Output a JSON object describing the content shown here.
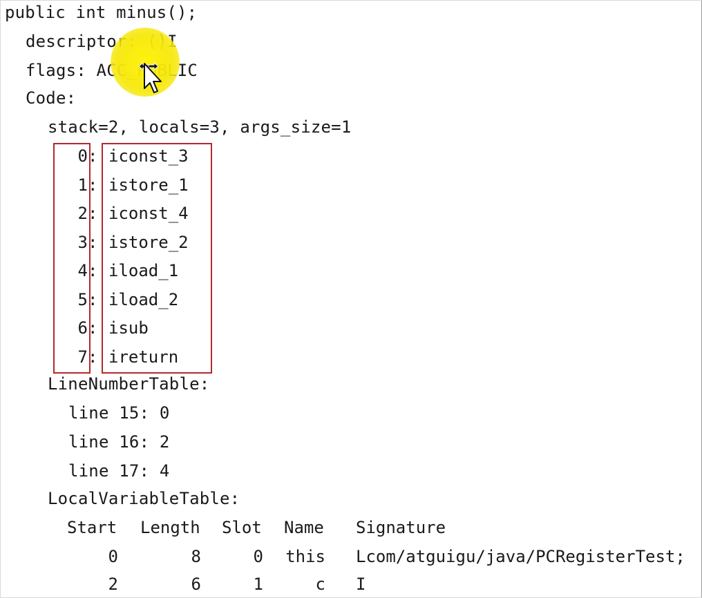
{
  "method": {
    "signature": "public int minus();",
    "descriptor": "descriptor: ()I",
    "flags_label": "flags: ",
    "flags_value": "ACC_PUBLIC",
    "code_label": "Code:",
    "stack_info": "stack=2, locals=3, args_size=1"
  },
  "instructions": [
    {
      "index": "0",
      "op": "iconst_3"
    },
    {
      "index": "1",
      "op": "istore_1"
    },
    {
      "index": "2",
      "op": "iconst_4"
    },
    {
      "index": "3",
      "op": "istore_2"
    },
    {
      "index": "4",
      "op": "iload_1"
    },
    {
      "index": "5",
      "op": "iload_2"
    },
    {
      "index": "6",
      "op": "isub"
    },
    {
      "index": "7",
      "op": "ireturn"
    }
  ],
  "line_number_table": {
    "title": "LineNumberTable:",
    "rows": [
      "line 15: 0",
      "line 16: 2",
      "line 17: 4"
    ]
  },
  "local_variable_table": {
    "title": "LocalVariableTable:",
    "headers": [
      "Start",
      "Length",
      "Slot",
      "Name",
      "Signature"
    ],
    "rows": [
      [
        "0",
        "8",
        "0",
        "this",
        "Lcom/atguigu/java/PCRegisterTest;"
      ],
      [
        "2",
        "6",
        "1",
        "c",
        "I"
      ]
    ]
  },
  "colors": {
    "box_border": "#b0282d",
    "highlight": "#f6e80a"
  },
  "icons": {
    "cursor": "move-cursor-icon"
  }
}
